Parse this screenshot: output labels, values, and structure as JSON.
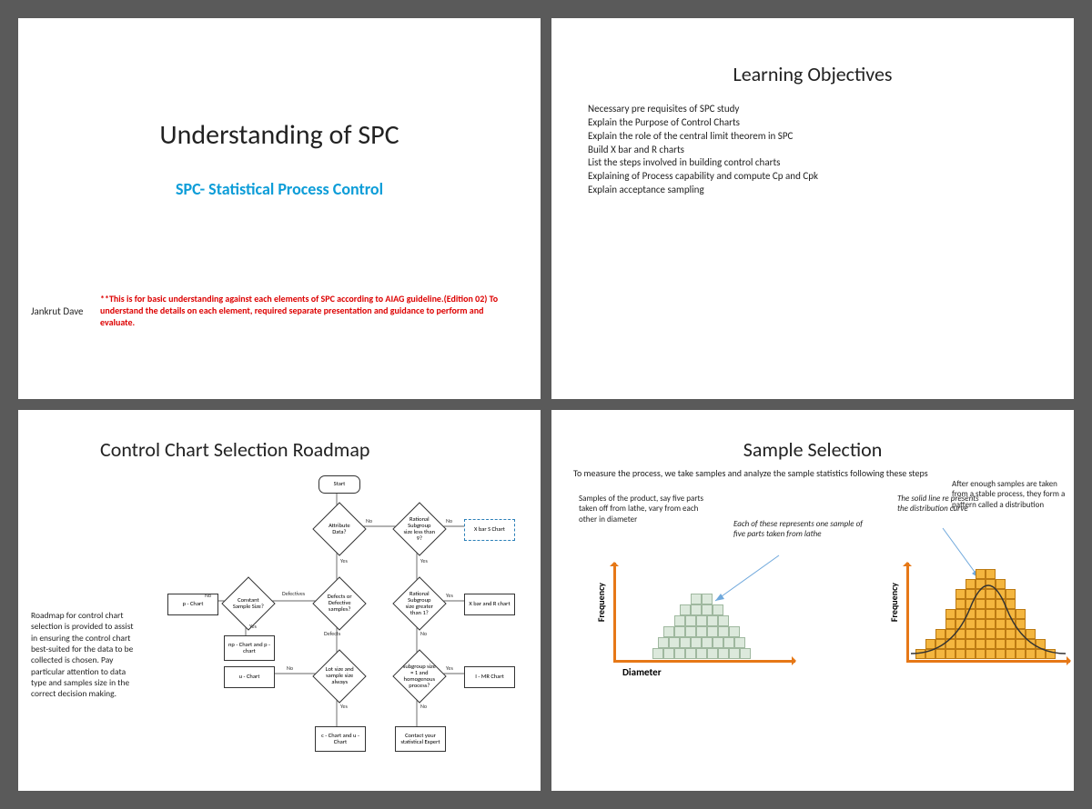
{
  "slide1": {
    "title": "Understanding of SPC",
    "subtitle": "SPC- Statistical Process Control",
    "author": "Jankrut Dave",
    "note": "**This is for basic understanding against each elements of SPC according to AIAG guideline.(Edition 02) To understand the details on each element, required separate presentation and guidance to perform and evaluate."
  },
  "slide2": {
    "title": "Learning Objectives",
    "items": [
      "Necessary pre requisites of SPC study",
      "Explain the Purpose of Control Charts",
      "Explain the role of the central limit theorem in SPC",
      "Build X bar and R charts",
      "List the steps involved in building control charts",
      "Explaining of Process capability and compute Cp and Cpk",
      "Explain acceptance sampling"
    ]
  },
  "slide3": {
    "title": "Control Chart Selection Roadmap",
    "body": "Roadmap for control chart selection is provided to assist in ensuring the control chart best-suited for the data to be collected is chosen. Pay particular attention to data type and samples size in the correct decision making.",
    "nodes": {
      "start": "Start",
      "attr": "Attribute Data?",
      "rsub9": "Rational Subgroup size less than 9?",
      "xbars": "X bar S Chart",
      "csize": "Constant Sample Size?",
      "defects": "Defects or Defective samples?",
      "rsub1": "Rational Subgroup size greater than 1?",
      "xbarr": "X bar and R chart",
      "pchart": "p - Chart",
      "npchart": "np - Chart and p - chart",
      "uchart": "u - Chart",
      "lotsize": "Lot size and sample size always",
      "sub1h": "subgroup size = 1 and homogenous process?",
      "imr": "I - MR Chart",
      "cuchart": "c - Chart and u - Chart",
      "expert": "Contact your statistical Expert"
    },
    "labels": {
      "yes": "Yes",
      "no": "No",
      "defectives": "Defectives",
      "defects": "Defects"
    }
  },
  "slide4": {
    "title": "Sample Selection",
    "subtitle": "To measure the process, we take samples and analyze the sample statistics following these steps",
    "t1": "Samples of the product, say five parts taken off from lathe, vary from each other in diameter",
    "t2": "Each of these represents one sample of five parts taken from lathe",
    "t3": "The solid line re presents the distribution curve",
    "t4": "After enough samples are taken from a stable process, they form a pattern called a distribution",
    "xlabel": "Diameter",
    "ylabel": "Frequency"
  }
}
